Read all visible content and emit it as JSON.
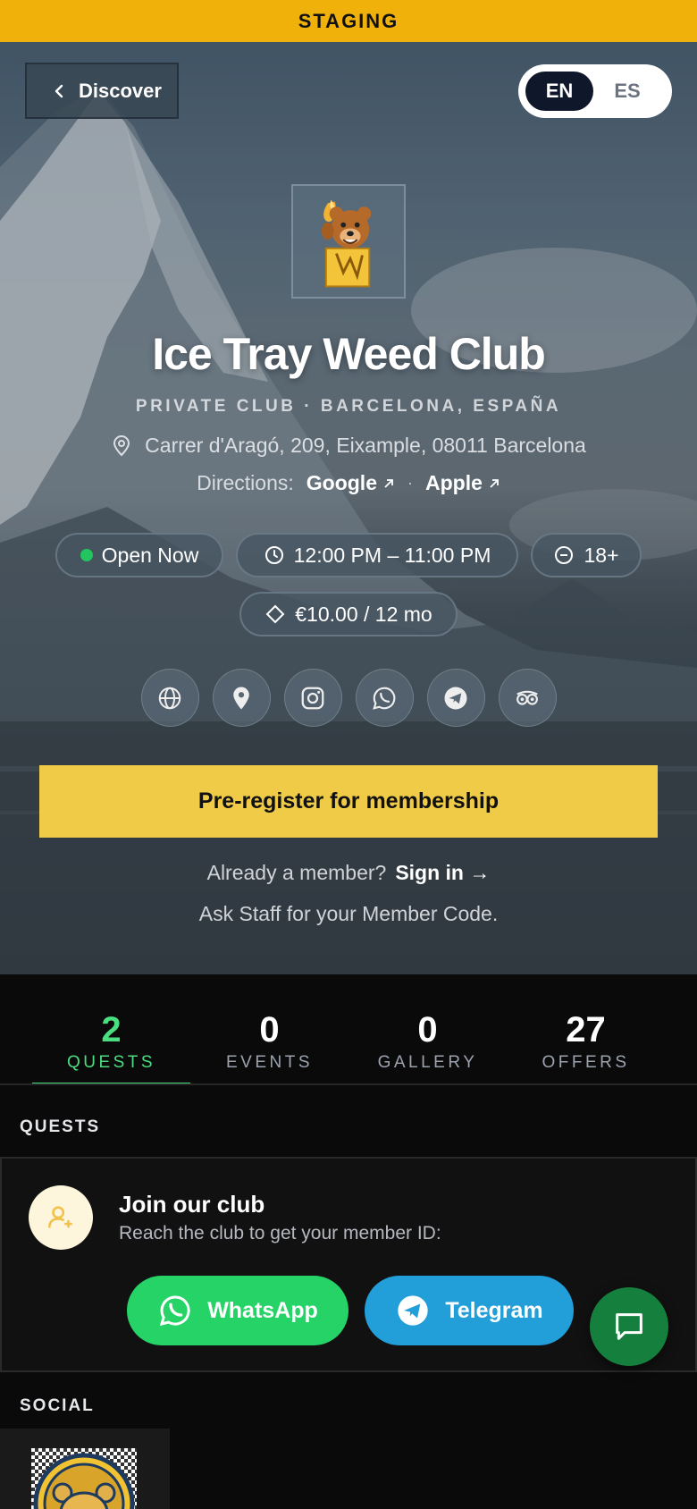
{
  "banner": {
    "label": "STAGING"
  },
  "nav": {
    "back_label": "Discover"
  },
  "language": {
    "options": [
      "EN",
      "ES"
    ],
    "active": "EN"
  },
  "club": {
    "name": "Ice Tray Weed Club",
    "subtitle": "PRIVATE CLUB · BARCELONA, ESPAÑA",
    "address": "Carrer d'Aragó, 209, Eixample, 08011 Barcelona",
    "directions_label": "Directions:",
    "directions_links": [
      "Google",
      "Apple"
    ],
    "directions_sep": "·",
    "status": "Open Now",
    "hours": "12:00 PM – 11:00 PM",
    "age": "18+",
    "price": "€10.00 / 12 mo"
  },
  "social_icons": [
    "globe-icon",
    "map-pin-icon",
    "instagram-icon",
    "whatsapp-icon",
    "telegram-icon",
    "tripadvisor-icon"
  ],
  "cta": {
    "label": "Pre-register for membership"
  },
  "member": {
    "prompt": "Already a member?",
    "signin": "Sign in →",
    "hint": "Ask Staff for your Member Code."
  },
  "tabs": [
    {
      "count": "2",
      "label": "QUESTS",
      "active": true
    },
    {
      "count": "0",
      "label": "EVENTS",
      "active": false
    },
    {
      "count": "0",
      "label": "GALLERY",
      "active": false
    },
    {
      "count": "27",
      "label": "OFFERS",
      "active": false
    }
  ],
  "quests": {
    "heading": "QUESTS",
    "card": {
      "title": "Join our club",
      "subtitle": "Reach the club to get your member ID:",
      "whatsapp_label": "WhatsApp",
      "telegram_label": "Telegram"
    }
  },
  "social": {
    "heading": "SOCIAL"
  },
  "colors": {
    "accent_green": "#4ade80",
    "cta_yellow": "#f0cb47",
    "staging": "#f0b20a",
    "whatsapp": "#25d366",
    "telegram": "#229ed9",
    "chat_fab": "#15803d"
  }
}
